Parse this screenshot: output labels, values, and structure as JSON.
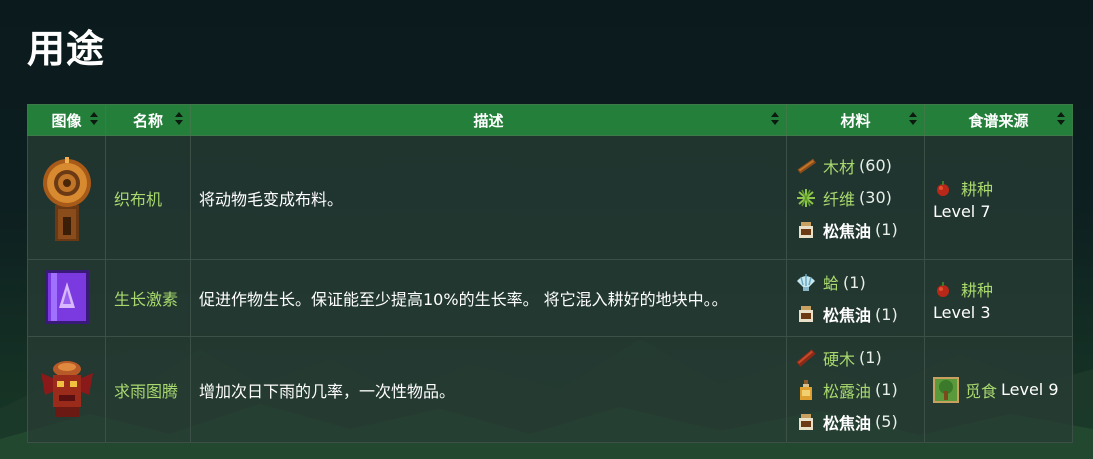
{
  "page_title": "用途",
  "columns": {
    "image": "图像",
    "name": "名称",
    "description": "描述",
    "materials": "材料",
    "recipe_source": "食谱来源"
  },
  "rows": [
    {
      "name": "织布机",
      "description": "将动物毛变成布料。",
      "icon": "loom-icon",
      "materials": [
        {
          "name": "木材",
          "qty": "(60)",
          "icon": "wood-icon",
          "link": true
        },
        {
          "name": "纤维",
          "qty": "(30)",
          "icon": "fiber-icon",
          "link": true
        },
        {
          "name": "松焦油",
          "qty": "(1)",
          "icon": "pine-tar-icon",
          "link": false
        }
      ],
      "source": {
        "name": "耕种",
        "level": "Level 7",
        "icon": "farming-icon"
      }
    },
    {
      "name": "生长激素",
      "description": "促进作物生长。保证能至少提高10%的生长率。 将它混入耕好的地块中。。",
      "icon": "speed-gro-icon",
      "materials": [
        {
          "name": "蛤",
          "qty": "(1)",
          "icon": "clam-icon",
          "link": true
        },
        {
          "name": "松焦油",
          "qty": "(1)",
          "icon": "pine-tar-icon",
          "link": false
        }
      ],
      "source": {
        "name": "耕种",
        "level": "Level 3",
        "icon": "farming-icon"
      }
    },
    {
      "name": "求雨图腾",
      "description": "增加次日下雨的几率，一次性物品。",
      "icon": "rain-totem-icon",
      "materials": [
        {
          "name": "硬木",
          "qty": "(1)",
          "icon": "hardwood-icon",
          "link": true
        },
        {
          "name": "松露油",
          "qty": "(1)",
          "icon": "truffle-oil-icon",
          "link": true
        },
        {
          "name": "松焦油",
          "qty": "(5)",
          "icon": "pine-tar-icon",
          "link": false
        }
      ],
      "source": {
        "name": "觅食",
        "level": "Level 9",
        "icon": "foraging-icon"
      }
    }
  ],
  "colors": {
    "header_bg": "#247f3a",
    "link_green": "#a8d86e",
    "row_bg": "#283c34"
  }
}
